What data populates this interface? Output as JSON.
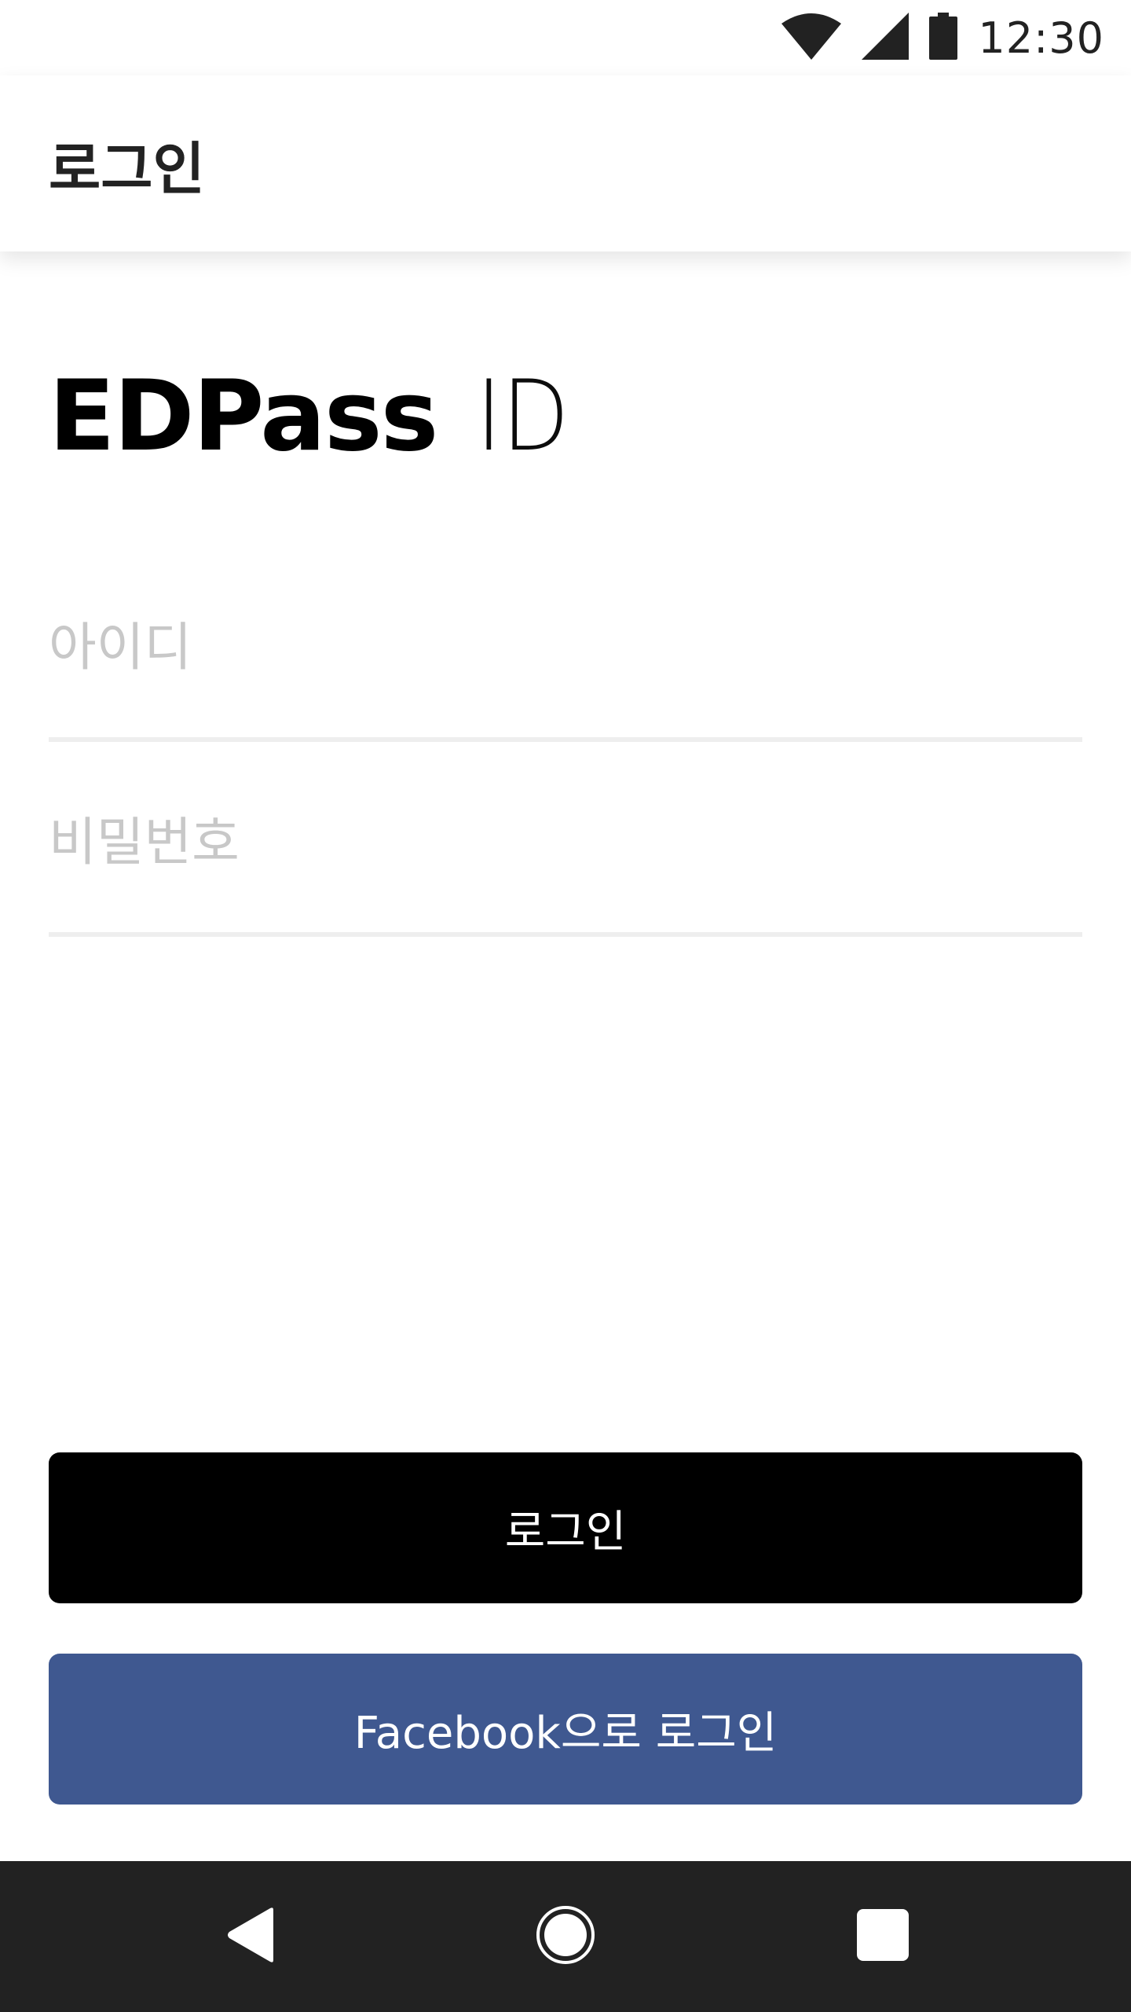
{
  "status_bar": {
    "time": "12:30",
    "icons": [
      "wifi-icon",
      "signal-icon",
      "battery-icon"
    ]
  },
  "app_bar": {
    "title": "로그인"
  },
  "logo": {
    "bold_text": "EDPass",
    "light_text": "ID"
  },
  "form": {
    "id_field": {
      "placeholder": "아이디",
      "value": ""
    },
    "password_field": {
      "placeholder": "비밀번호",
      "value": ""
    }
  },
  "buttons": {
    "login_label": "로그인",
    "facebook_label": "Facebook으로 로그인"
  },
  "nav_bar": {
    "icons": [
      "back-icon",
      "home-icon",
      "recent-apps-icon"
    ]
  },
  "colors": {
    "login_button": "#000000",
    "facebook_button": "#3f5890",
    "nav_bar": "#222222",
    "placeholder": "#c8c8c8",
    "divider": "#eeeeee"
  }
}
